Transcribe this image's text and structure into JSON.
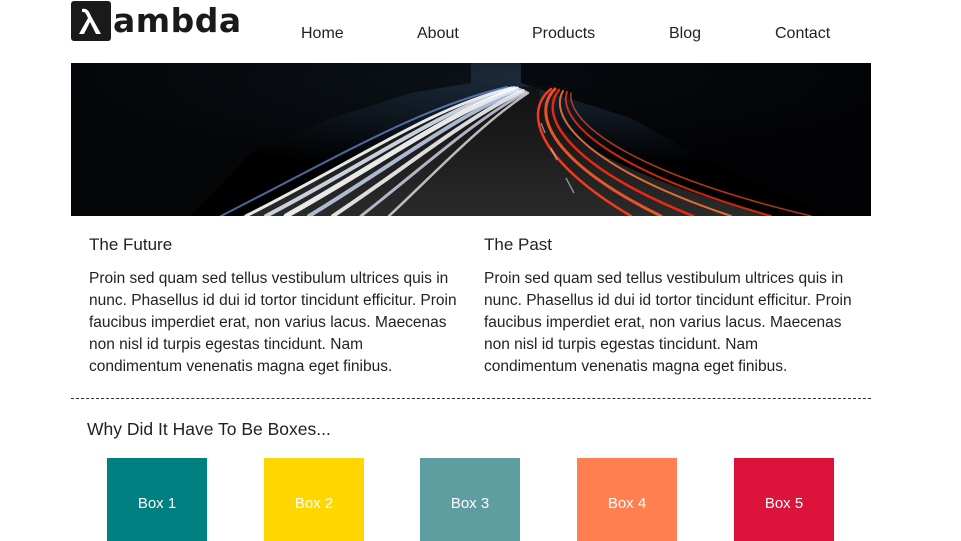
{
  "brand": {
    "logo_text": "ambda",
    "logo_icon": "lambda-icon"
  },
  "nav": {
    "items": [
      {
        "label": "Home"
      },
      {
        "label": "About"
      },
      {
        "label": "Products"
      },
      {
        "label": "Blog"
      },
      {
        "label": "Contact"
      }
    ]
  },
  "hero": {
    "image": "highway-light-trails-at-night"
  },
  "columns": [
    {
      "title": "The Future",
      "body": "Proin sed quam sed tellus vestibulum ultrices quis in nunc. Phasellus id dui id tortor tincidunt efficitur. Proin faucibus imperdiet erat, non varius lacus. Maecenas non nisl id turpis egestas tincidunt. Nam condimentum venenatis magna eget finibus."
    },
    {
      "title": "The Past",
      "body": "Proin sed quam sed tellus vestibulum ultrices quis in nunc. Phasellus id dui id tortor tincidunt efficitur. Proin faucibus imperdiet erat, non varius lacus. Maecenas non nisl id turpis egestas tincidunt. Nam condimentum venenatis magna eget finibus."
    }
  ],
  "boxes_section": {
    "title": "Why Did It Have To Be Boxes...",
    "boxes": [
      {
        "label": "Box 1",
        "color": "#008080"
      },
      {
        "label": "Box 2",
        "color": "#FFD700"
      },
      {
        "label": "Box 3",
        "color": "#5F9EA0"
      },
      {
        "label": "Box 4",
        "color": "#FF7F50"
      },
      {
        "label": "Box 5",
        "color": "#DC143C"
      }
    ]
  }
}
